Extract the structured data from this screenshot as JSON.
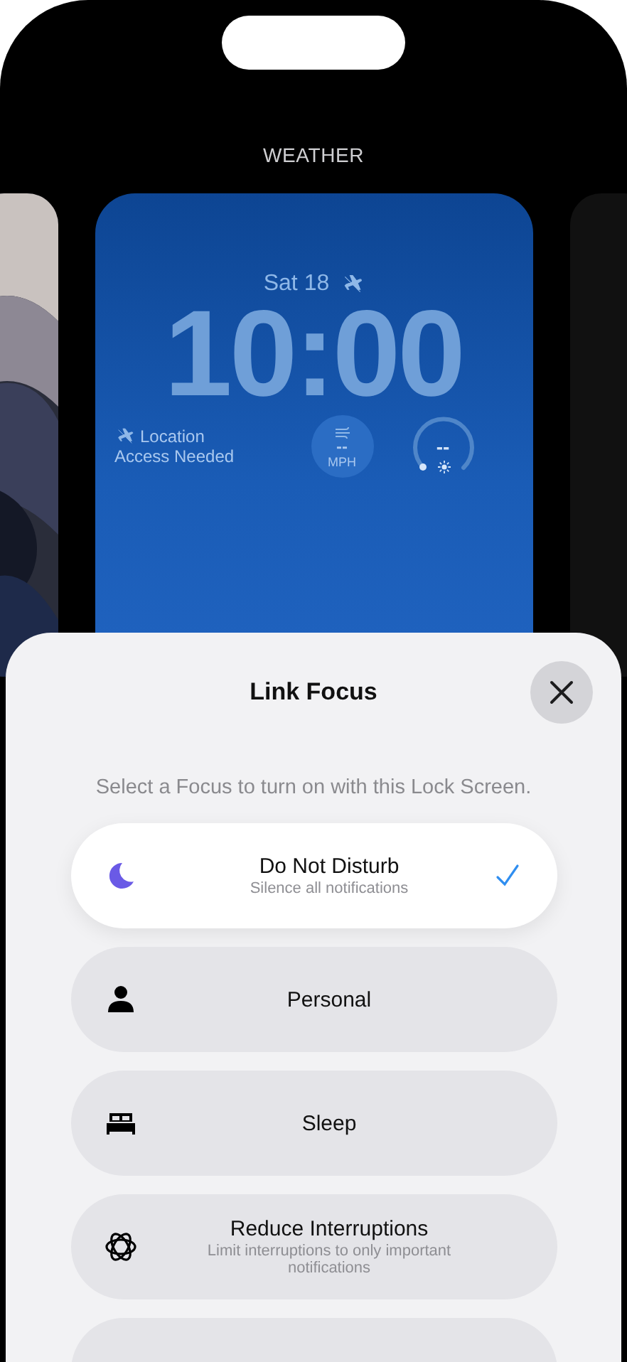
{
  "header": {
    "label": "WEATHER"
  },
  "lock_screen": {
    "date": "Sat 18",
    "time": "10:00",
    "location_lines": [
      "Location",
      "Access Needed"
    ],
    "wind": {
      "value": "--",
      "unit": "MPH"
    },
    "gauge": {
      "value": "--"
    }
  },
  "sheet": {
    "title": "Link Focus",
    "subtitle": "Select a Focus to turn on with this Lock Screen.",
    "focuses": [
      {
        "name": "Do Not Disturb",
        "description": "Silence all notifications",
        "kind": "moon",
        "selected": true
      },
      {
        "name": "Personal",
        "kind": "person",
        "selected": false
      },
      {
        "name": "Sleep",
        "kind": "bed",
        "selected": false
      },
      {
        "name": "Reduce Interruptions",
        "description": "Limit interruptions to only important notifications",
        "kind": "atom",
        "selected": false
      }
    ]
  }
}
